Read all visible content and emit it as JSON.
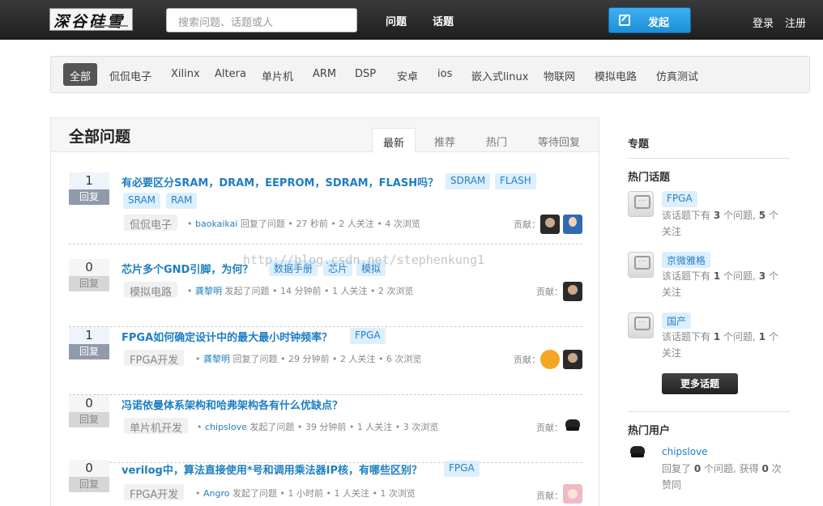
{
  "header": {
    "logo_text": "深谷硅雪",
    "search_placeholder": "搜索问题、话题或人",
    "nav": [
      "问题",
      "话题"
    ],
    "publish_label": "发起",
    "login": "登录",
    "register": "注册"
  },
  "categories": [
    "全部",
    "侃侃电子",
    "Xilinx",
    "Altera",
    "单片机",
    "ARM",
    "DSP",
    "安卓",
    "ios",
    "嵌入式linux",
    "物联网",
    "模拟电路",
    "仿真测试"
  ],
  "main": {
    "title": "全部问题",
    "tabs": [
      "最新",
      "推荐",
      "热门",
      "等待回复"
    ],
    "contrib_label": "贡献：",
    "questions": [
      {
        "votes": "1",
        "vote_label": "回复",
        "title": "有必要区分SRAM，DRAM，EEPROM，SDRAM，FLASH吗？",
        "tags": [
          "SDRAM",
          "FLASH",
          "SRAM",
          "RAM"
        ],
        "category": "侃侃电子",
        "user": "baokaikai",
        "meta": "回复了问题 • 27 秒前 • 2 人关注 • 4 次浏览"
      },
      {
        "votes": "0",
        "vote_label": "回复",
        "title": "芯片多个GND引脚，为何？",
        "tags": [
          "数据手册",
          "芯片",
          "模拟"
        ],
        "category": "模拟电路",
        "user": "龚黎明",
        "meta": "发起了问题 • 14 分钟前 • 1 人关注 • 2 次浏览"
      },
      {
        "votes": "1",
        "vote_label": "回复",
        "title": "FPGA如何确定设计中的最大最小时钟频率？",
        "tags": [
          "FPGA"
        ],
        "category": "FPGA开发",
        "user": "龚黎明",
        "meta": "回复了问题 • 29 分钟前 • 2 人关注 • 6 次浏览"
      },
      {
        "votes": "0",
        "vote_label": "回复",
        "title": "冯诺依曼体系架构和哈弗架构各有什么优缺点？",
        "tags": [],
        "category": "单片机开发",
        "user": "chipslove",
        "meta": "发起了问题 • 39 分钟前 • 1 人关注 • 3 次浏览"
      },
      {
        "votes": "0",
        "vote_label": "回复",
        "title": "verilog中，算法直接使用*号和调用乘法器IP核，有哪些区别？",
        "tags": [
          "FPGA"
        ],
        "category": "FPGA开发",
        "user": "Angro",
        "meta": "发起了问题 • 1 小时前 • 1 人关注 • 1 次浏览"
      }
    ]
  },
  "watermark": "http://blog.csdn.net/stephenkung1",
  "sidebar": {
    "topics_heading": "专题",
    "hot_topics_heading": "热门话题",
    "desc_prefix": "该话题下有",
    "desc_mid": "个问题,",
    "desc_suffix": "个关注",
    "hot_topics": [
      {
        "name": "FPGA",
        "questions": "3",
        "followers": "5"
      },
      {
        "name": "京微雅格",
        "questions": "1",
        "followers": "3"
      },
      {
        "name": "国产",
        "questions": "1",
        "followers": "1"
      }
    ],
    "more_topics": "更多话题",
    "hot_users_heading": "热门用户",
    "hot_user": {
      "name": "chipslove",
      "answers": "0",
      "likes": "0",
      "p1": "回复了",
      "p2": "个问题, 获得",
      "p3": "次赞同"
    }
  }
}
